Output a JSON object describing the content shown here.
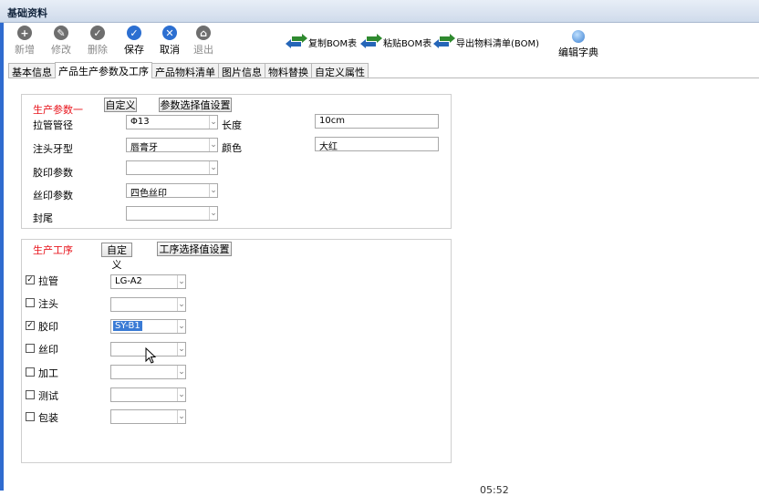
{
  "window": {
    "title": "基础资料"
  },
  "toolbar": {
    "new": "新增",
    "edit": "修改",
    "delete": "删除",
    "save": "保存",
    "cancel": "取消",
    "exit": "退出",
    "copy_bom": "复制BOM表",
    "paste_bom": "粘贴BOM表",
    "export_bom": "导出物料清单(BOM)",
    "edit_dict": "编辑字典"
  },
  "tabs": [
    "基本信息",
    "产品生产参数及工序",
    "产品物料清单",
    "图片信息",
    "物料替换",
    "自定义属性"
  ],
  "params": {
    "header": "生产参数一",
    "custom_button": "自定义",
    "select_button": "参数选择值设置",
    "rows": [
      {
        "label": "拉管管径",
        "value": "Φ13"
      },
      {
        "label": "注头牙型",
        "value": "唇膏牙"
      },
      {
        "label": "胶印参数",
        "value": ""
      },
      {
        "label": "丝印参数",
        "value": "四色丝印"
      },
      {
        "label": "封尾",
        "value": ""
      }
    ],
    "right_rows": [
      {
        "label": "长度",
        "value": "10cm"
      },
      {
        "label": "颜色",
        "value": "大红"
      }
    ]
  },
  "process": {
    "header": "生产工序",
    "custom_button": "自定义",
    "select_button": "工序选择值设置",
    "rows": [
      {
        "label": "拉管",
        "checked": true,
        "value": "LG-A2"
      },
      {
        "label": "注头",
        "checked": false,
        "value": ""
      },
      {
        "label": "胶印",
        "checked": true,
        "value": "SY-B1"
      },
      {
        "label": "丝印",
        "checked": false,
        "value": ""
      },
      {
        "label": "加工",
        "checked": false,
        "value": ""
      },
      {
        "label": "测试",
        "checked": false,
        "value": ""
      },
      {
        "label": "包装",
        "checked": false,
        "value": ""
      }
    ]
  },
  "status": {
    "time": "05:52"
  },
  "colors": {
    "accent": "#2c6fd1",
    "required_label": "#e8141c"
  }
}
